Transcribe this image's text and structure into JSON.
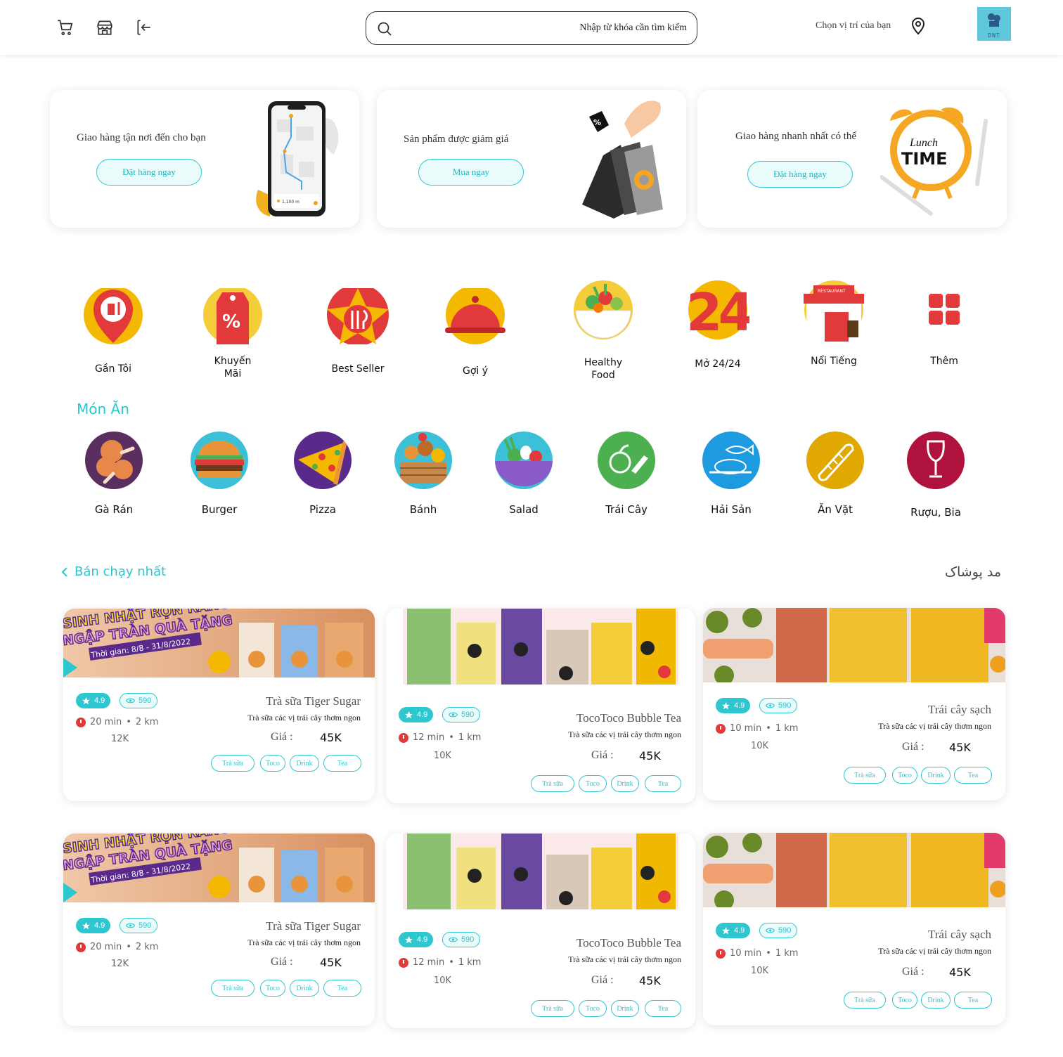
{
  "header": {
    "search_placeholder": "Nhập từ khóa cần tìm kiếm",
    "location_label": "Chọn vị trí của bạn",
    "avatar_text": "DNT"
  },
  "promos": [
    {
      "title": "Giao hàng tận nơi đến cho bạn",
      "button": "Đặt hàng ngay",
      "phone_text": "1,100 m"
    },
    {
      "title": "Sản phẩm được giảm giá",
      "button": "Mua ngay"
    },
    {
      "title": "Giao hàng nhanh nhất có thể",
      "button": "Đặt hàng ngay",
      "clock_text_1": "Lunch",
      "clock_text_2": "TIME"
    }
  ],
  "categories": [
    {
      "label": "Gần Tôi",
      "icon": "map-pin-drink-icon"
    },
    {
      "label": "Khuyến\nMãi",
      "icon": "discount-tag-icon"
    },
    {
      "label": "Best Seller",
      "icon": "star-cutlery-icon"
    },
    {
      "label": "Gợi ý",
      "icon": "cloche-icon"
    },
    {
      "label": "Healthy\nFood",
      "icon": "salad-bowl-icon"
    },
    {
      "label": "Mở 24/24",
      "icon": "open-24-icon",
      "icon_text": "24"
    },
    {
      "label": "Nổi Tiếng",
      "icon": "restaurant-icon",
      "icon_text": "RESTAURANT"
    },
    {
      "label": "Thêm",
      "icon": "grid-more-icon"
    }
  ],
  "foods_title": "Món Ăn",
  "foods": [
    {
      "label": "Gà Rán",
      "icon": "fried-chicken-icon"
    },
    {
      "label": "Burger",
      "icon": "burger-icon"
    },
    {
      "label": "Pizza",
      "icon": "pizza-icon"
    },
    {
      "label": "Bánh",
      "icon": "bakery-icon"
    },
    {
      "label": "Salad",
      "icon": "salad-icon"
    },
    {
      "label": "Trái Cây",
      "icon": "fruit-icon"
    },
    {
      "label": "Hải Sản",
      "icon": "seafood-icon"
    },
    {
      "label": "Ăn Vặt",
      "icon": "snack-icon"
    },
    {
      "label": "Rượu, Bia",
      "icon": "wine-icon"
    }
  ],
  "bestseller": {
    "title": "Bán chạy nhất",
    "right_text": "مد پوشاک"
  },
  "banners": {
    "tiger_line1": "SINH NHẬT RỘN RÀNG",
    "tiger_line2": "NGẬP TRÀN QUÀ TẶNG",
    "tiger_line3": "Thời gian: 8/8 - 31/8/2022"
  },
  "products": [
    {
      "rating": "4.9",
      "views": "590",
      "time": "20 min",
      "distance": "2 km",
      "small_price": "12K",
      "name": "Trà sữa Tiger Sugar",
      "desc": "Trà sữa các vị trái cây thơm ngon",
      "price_label": "Giá :",
      "price": "45K",
      "tags": [
        "Trà sữa",
        "Toco",
        "Drink",
        "Tea"
      ]
    },
    {
      "rating": "4.9",
      "views": "590",
      "time": "12 min",
      "distance": "1 km",
      "small_price": "10K",
      "name": "TocoToco Bubble Tea",
      "desc": "Trà sữa các vị trái cây thơm ngon",
      "price_label": "Giá :",
      "price": "45K",
      "tags": [
        "Trà sữa",
        "Toco",
        "Drink",
        "Tea"
      ]
    },
    {
      "rating": "4.9",
      "views": "590",
      "time": "10 min",
      "distance": "1 km",
      "small_price": "10K",
      "name": "Trái cây sạch",
      "desc": "Trà sữa các vị trái cây thơm ngon",
      "price_label": "Giá :",
      "price": "45K",
      "tags": [
        "Trà sữa",
        "Toco",
        "Drink",
        "Tea"
      ]
    },
    {
      "rating": "4.9",
      "views": "590",
      "time": "20 min",
      "distance": "2 km",
      "small_price": "12K",
      "name": "Trà sữa Tiger Sugar",
      "desc": "Trà sữa các vị trái cây thơm ngon",
      "price_label": "Giá :",
      "price": "45K",
      "tags": [
        "Trà sữa",
        "Toco",
        "Drink",
        "Tea"
      ]
    },
    {
      "rating": "4.9",
      "views": "590",
      "time": "12 min",
      "distance": "1 km",
      "small_price": "10K",
      "name": "TocoToco Bubble Tea",
      "desc": "Trà sữa các vị trái cây thơm ngon",
      "price_label": "Giá :",
      "price": "45K",
      "tags": [
        "Trà sữa",
        "Toco",
        "Drink",
        "Tea"
      ]
    },
    {
      "rating": "4.9",
      "views": "590",
      "time": "10 min",
      "distance": "1 km",
      "small_price": "10K",
      "name": "Trái cây sạch",
      "desc": "Trà sữa các vị trái cây thơm ngon",
      "price_label": "Giá :",
      "price": "45K",
      "tags": [
        "Trà sữa",
        "Toco",
        "Drink",
        "Tea"
      ]
    }
  ],
  "colors": {
    "accent": "#2ec6cf",
    "red": "#e23a3a",
    "yellow": "#f5b800"
  }
}
